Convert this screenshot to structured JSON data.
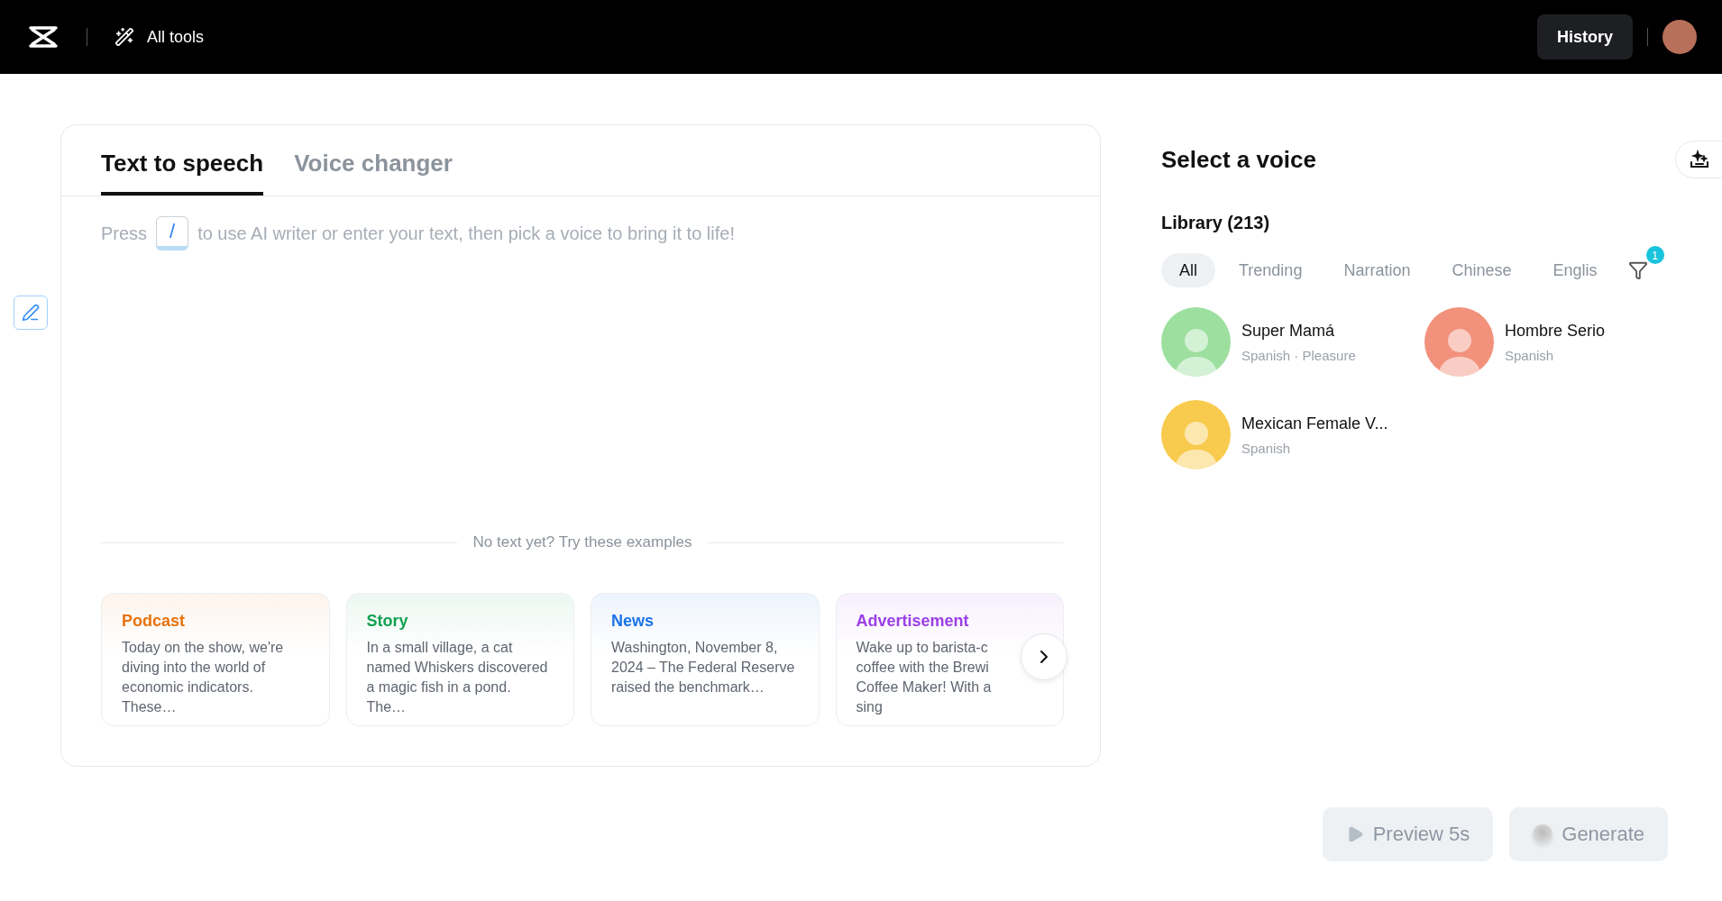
{
  "topbar": {
    "tools_label": "All tools",
    "history_button": "History"
  },
  "tabs": [
    {
      "label": "Text to speech",
      "selected": true
    },
    {
      "label": "Voice changer",
      "selected": false
    }
  ],
  "editor": {
    "prompt_before": "Press",
    "key": "/",
    "prompt_after": "to use AI writer or enter your text, then pick a voice to bring it to life!"
  },
  "examples": {
    "heading": "No text yet? Try these examples",
    "cards": [
      {
        "title": "Podcast",
        "color": "#e8710a",
        "text": "Today on the show, we're diving into the world of economic indicators. These…"
      },
      {
        "title": "Story",
        "color": "#12a150",
        "text": "In a small village, a cat named Whiskers discovered a magic fish in a pond. The…"
      },
      {
        "title": "News",
        "color": "#1a73e8",
        "text": "Washington, November 8, 2024 – The Federal Reserve raised the benchmark…"
      },
      {
        "title": "Advertisement",
        "color": "#9b3fe8",
        "text": "Wake up to barista-c coffee with the Brewi Coffee Maker! With a sing"
      }
    ]
  },
  "voice_panel": {
    "title": "Select a voice",
    "library": "Library (213)",
    "filter_count": "1",
    "chips": [
      {
        "label": "All",
        "selected": true
      },
      {
        "label": "Trending",
        "selected": false
      },
      {
        "label": "Narration",
        "selected": false
      },
      {
        "label": "Chinese",
        "selected": false
      },
      {
        "label": "Englis",
        "selected": false
      }
    ],
    "voices": [
      {
        "name": "Super Mamá",
        "tags": "Spanish · Pleasure",
        "color": "#9ddf9f"
      },
      {
        "name": "Hombre Serio",
        "tags": "Spanish",
        "color": "#f2917c"
      },
      {
        "name": "Mexican Female V...",
        "tags": "Spanish",
        "color": "#f8cb4e"
      }
    ]
  },
  "actions": [
    {
      "kind": "preview",
      "label": "Preview 5s",
      "disabled": true
    },
    {
      "kind": "generate",
      "label": "Generate",
      "disabled": true
    }
  ]
}
